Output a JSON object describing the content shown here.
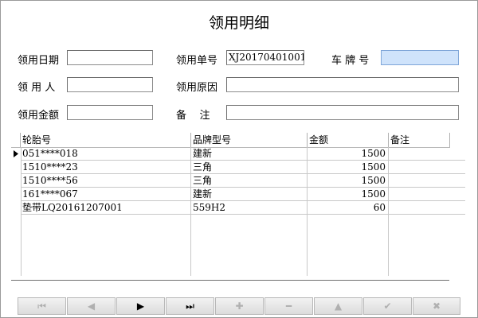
{
  "title": "领用明细",
  "form": {
    "date_label": "领用日期",
    "date_value": "",
    "order_no_label": "领用单号",
    "order_no_value": "XJ20170401001",
    "plate_label": "车 牌 号",
    "plate_value": "",
    "person_label": "领 用 人",
    "person_value": "",
    "reason_label": "领用原因",
    "reason_value": "",
    "amount_label": "领用金额",
    "amount_value": "",
    "remark_label": "备    注",
    "remark_value": ""
  },
  "grid": {
    "columns": [
      "轮胎号",
      "品牌型号",
      "金额",
      "备注"
    ],
    "rows": [
      {
        "tire_no": "051****018",
        "brand": "建新",
        "amount": "1500",
        "remark": ""
      },
      {
        "tire_no": "1510****23",
        "brand": "三角",
        "amount": "1500",
        "remark": ""
      },
      {
        "tire_no": "1510****56",
        "brand": "三角",
        "amount": "1500",
        "remark": ""
      },
      {
        "tire_no": "161****067",
        "brand": "建新",
        "amount": "1500",
        "remark": ""
      },
      {
        "tire_no": "垫带LQ20161207001",
        "brand": "559H2",
        "amount": "60",
        "remark": ""
      }
    ],
    "current_row_marker": "▸"
  },
  "navigator": {
    "first": "⏮",
    "prev": "◀",
    "next": "▶",
    "last": "⏭",
    "insert": "✚",
    "delete": "━",
    "edit": "▲",
    "post": "✔",
    "cancel": "✖"
  }
}
